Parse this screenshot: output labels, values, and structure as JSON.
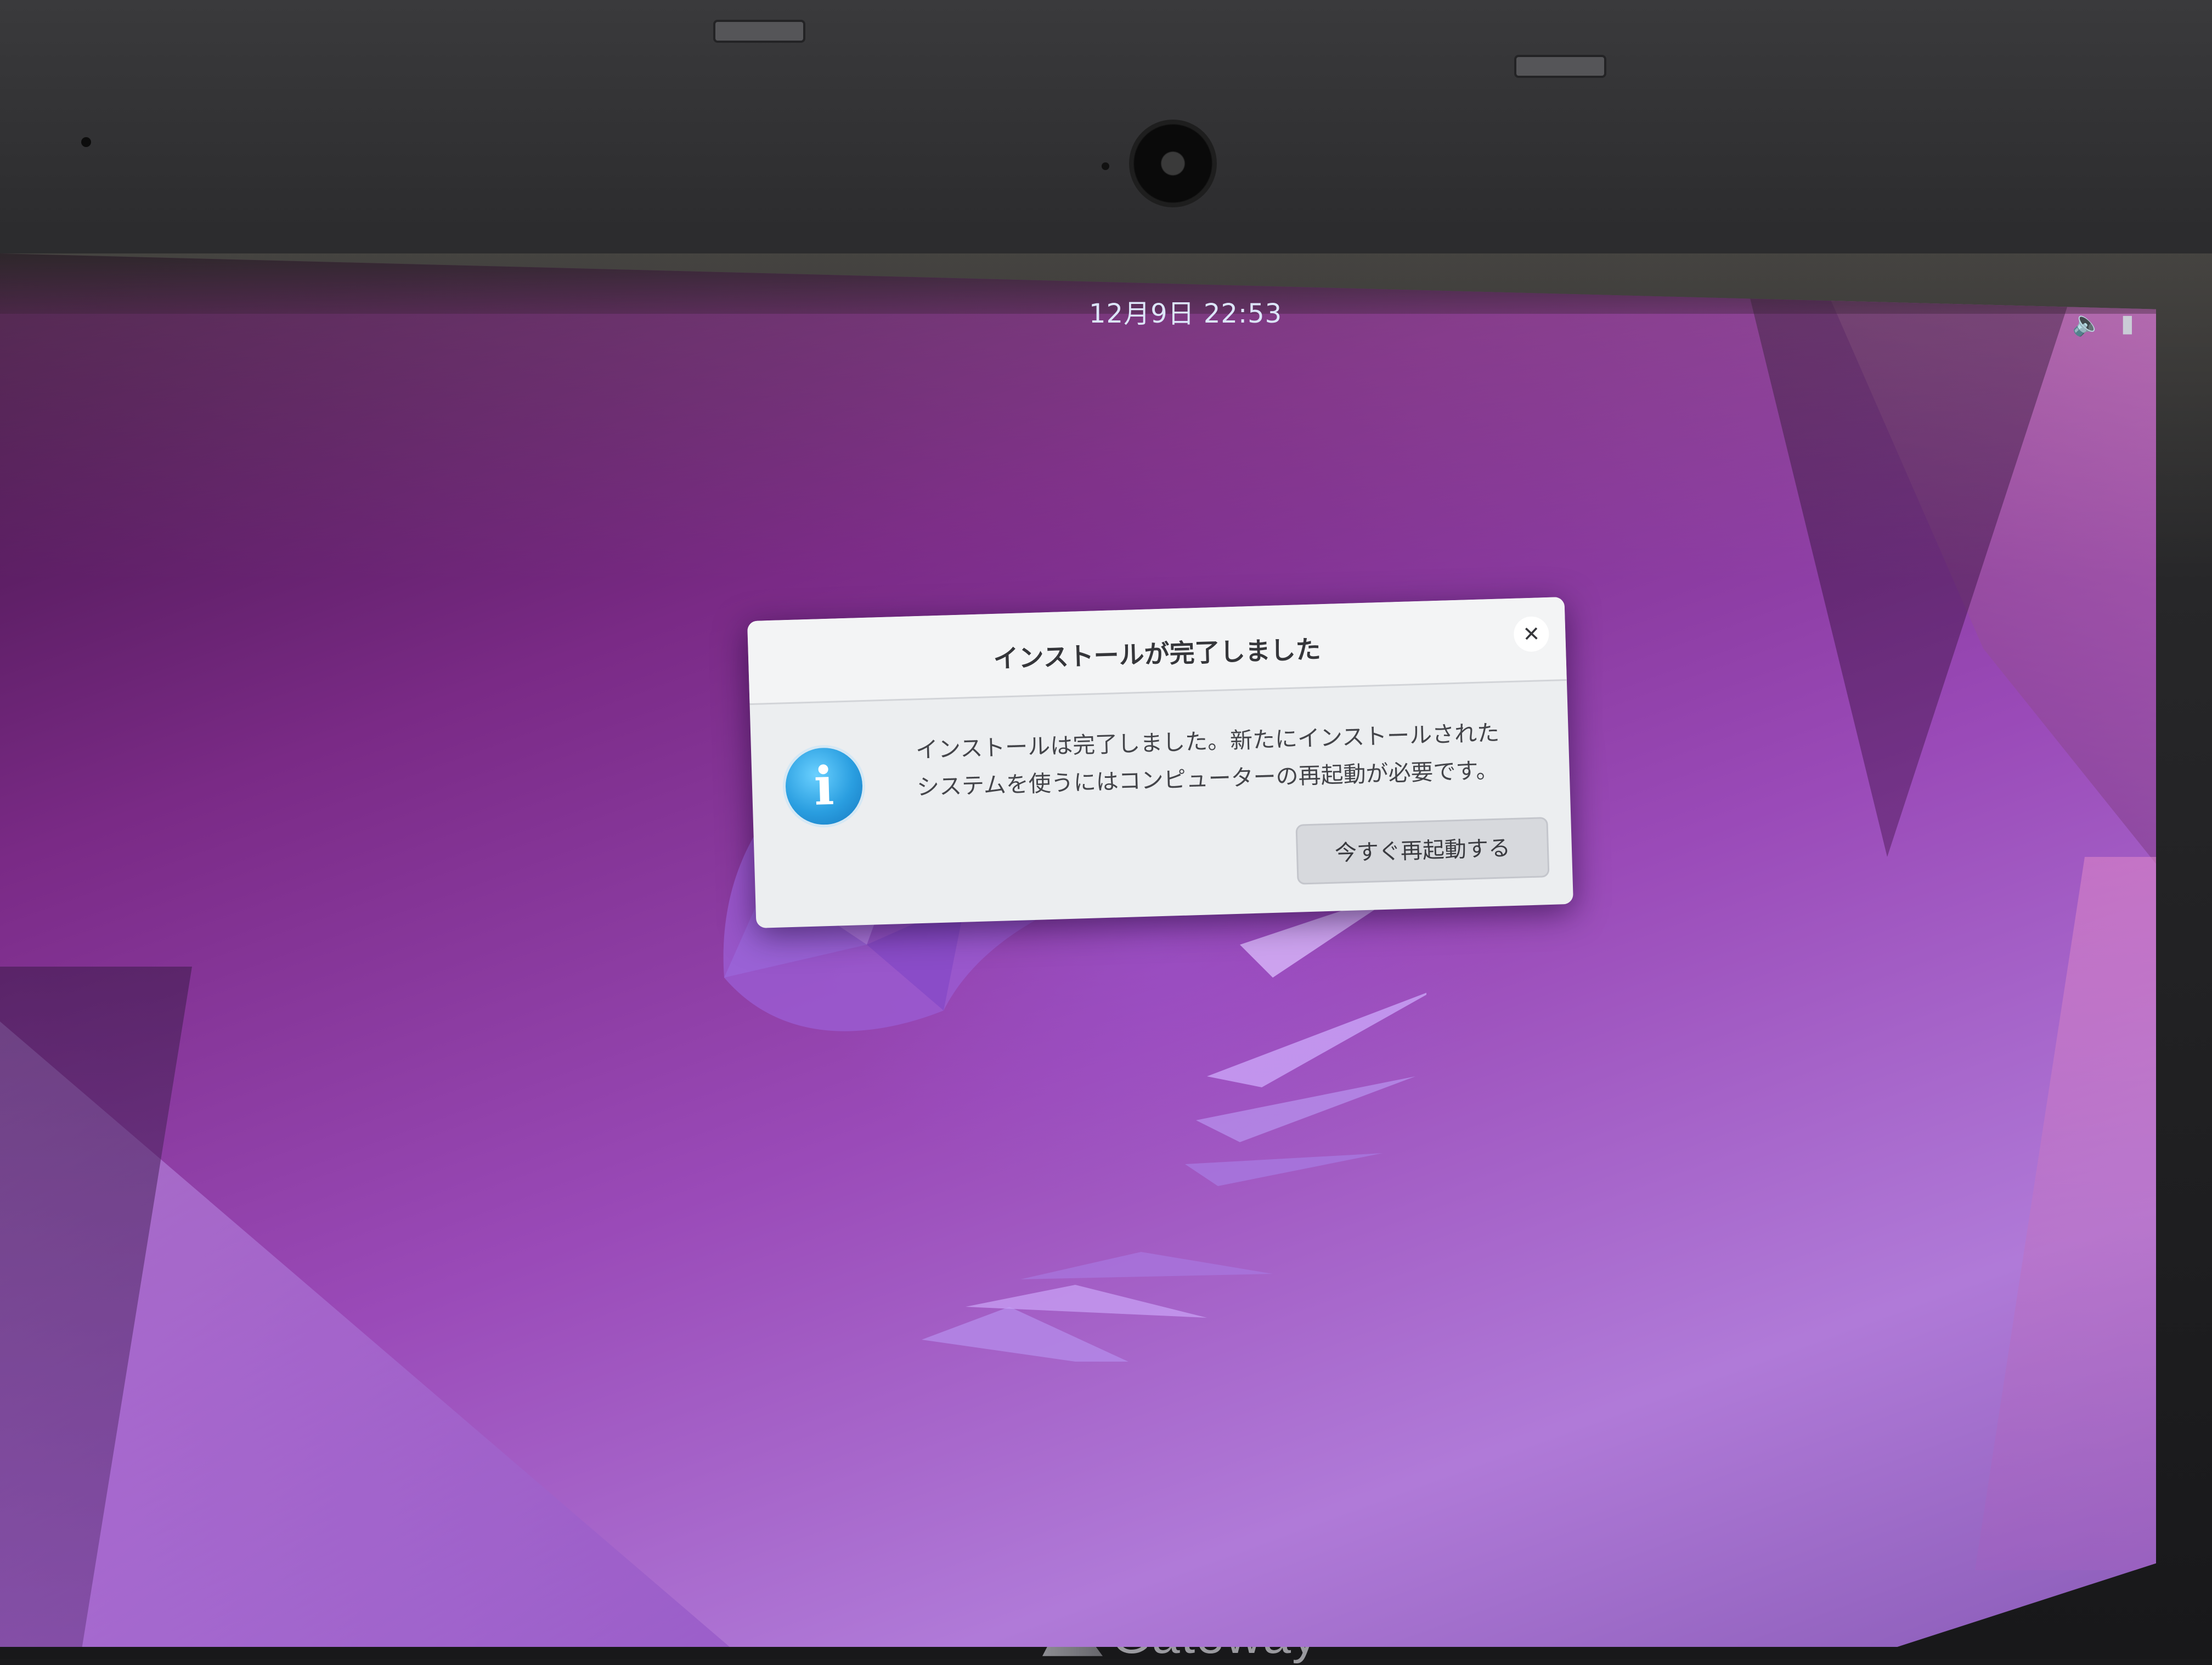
{
  "topbar": {
    "clock": "12月9日  22:53",
    "icons": [
      "volume-icon",
      "battery-icon"
    ]
  },
  "dialog": {
    "title": "インストールが完了しました",
    "close_icon": "close-icon",
    "info_icon": "info-icon",
    "info_glyph": "i",
    "message_line1": "インストールは完了しました。新たにインストールされた",
    "message_line2": "システムを使うにはコンピューターの再起動が必要です。",
    "restart_button": "今すぐ再起動する"
  },
  "hardware": {
    "brand": "Gateway"
  },
  "colors": {
    "wallpaper_accent": "#9a4ab8",
    "dialog_bg": "#eceef0",
    "info_blue": "#2a9ee0"
  }
}
